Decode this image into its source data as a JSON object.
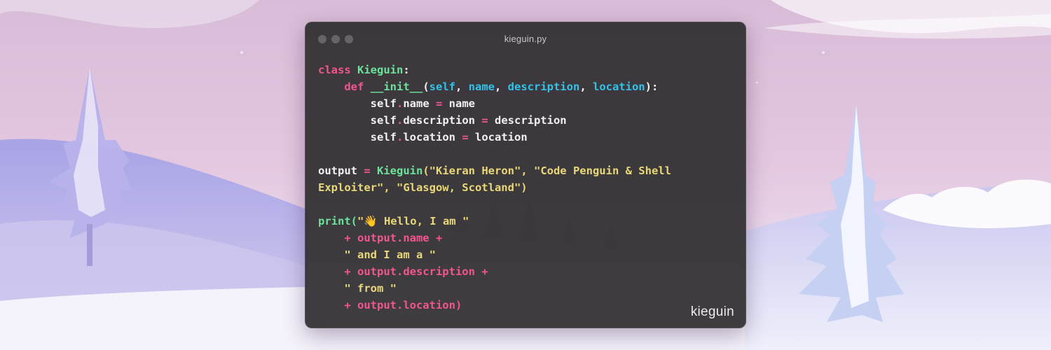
{
  "window": {
    "title": "kieguin.py",
    "brand": "kieguin"
  },
  "code_lines": [
    [
      {
        "t": "class ",
        "c": "kw"
      },
      {
        "t": "Kieguin",
        "c": "cls"
      },
      {
        "t": ":",
        "c": "pl"
      }
    ],
    [
      {
        "t": "    def ",
        "c": "kw"
      },
      {
        "t": "__init__",
        "c": "cls"
      },
      {
        "t": "(",
        "c": "pl"
      },
      {
        "t": "self",
        "c": "par"
      },
      {
        "t": ", ",
        "c": "pl"
      },
      {
        "t": "name",
        "c": "par"
      },
      {
        "t": ", ",
        "c": "pl"
      },
      {
        "t": "description",
        "c": "par"
      },
      {
        "t": ", ",
        "c": "pl"
      },
      {
        "t": "location",
        "c": "par"
      },
      {
        "t": "):",
        "c": "pl"
      }
    ],
    [
      {
        "t": "        self",
        "c": "pl"
      },
      {
        "t": ".",
        "c": "op"
      },
      {
        "t": "name ",
        "c": "pl"
      },
      {
        "t": "=",
        "c": "op"
      },
      {
        "t": " name",
        "c": "pl"
      }
    ],
    [
      {
        "t": "        self",
        "c": "pl"
      },
      {
        "t": ".",
        "c": "op"
      },
      {
        "t": "description ",
        "c": "pl"
      },
      {
        "t": "=",
        "c": "op"
      },
      {
        "t": " description",
        "c": "pl"
      }
    ],
    [
      {
        "t": "        self",
        "c": "pl"
      },
      {
        "t": ".",
        "c": "op"
      },
      {
        "t": "location ",
        "c": "pl"
      },
      {
        "t": "=",
        "c": "op"
      },
      {
        "t": " location",
        "c": "pl"
      }
    ],
    [],
    [
      {
        "t": "output ",
        "c": "pl"
      },
      {
        "t": "=",
        "c": "op"
      },
      {
        "t": " ",
        "c": "pl"
      },
      {
        "t": "Kieguin",
        "c": "cls"
      },
      {
        "t": "(\"Kieran Heron\", \"Code Penguin & Shell",
        "c": "str"
      }
    ],
    [
      {
        "t": "Exploiter\", \"Glasgow, Scotland\")",
        "c": "str"
      }
    ],
    [],
    [
      {
        "t": "print(",
        "c": "cls"
      },
      {
        "t": "\"👋 Hello, I am \"",
        "c": "str"
      }
    ],
    [
      {
        "t": "    + output.name +",
        "c": "kw"
      }
    ],
    [
      {
        "t": "    \" and I am a \"",
        "c": "str"
      }
    ],
    [
      {
        "t": "    + output.description +",
        "c": "kw"
      }
    ],
    [
      {
        "t": "    \" from \"",
        "c": "str"
      }
    ],
    [
      {
        "t": "    + output.location)",
        "c": "kw"
      }
    ]
  ],
  "colors": {
    "keyword": "#f2558f",
    "class_name": "#6be39a",
    "parameter": "#33c2e8",
    "string": "#e9d77a",
    "plain": "#f2f0f2"
  }
}
